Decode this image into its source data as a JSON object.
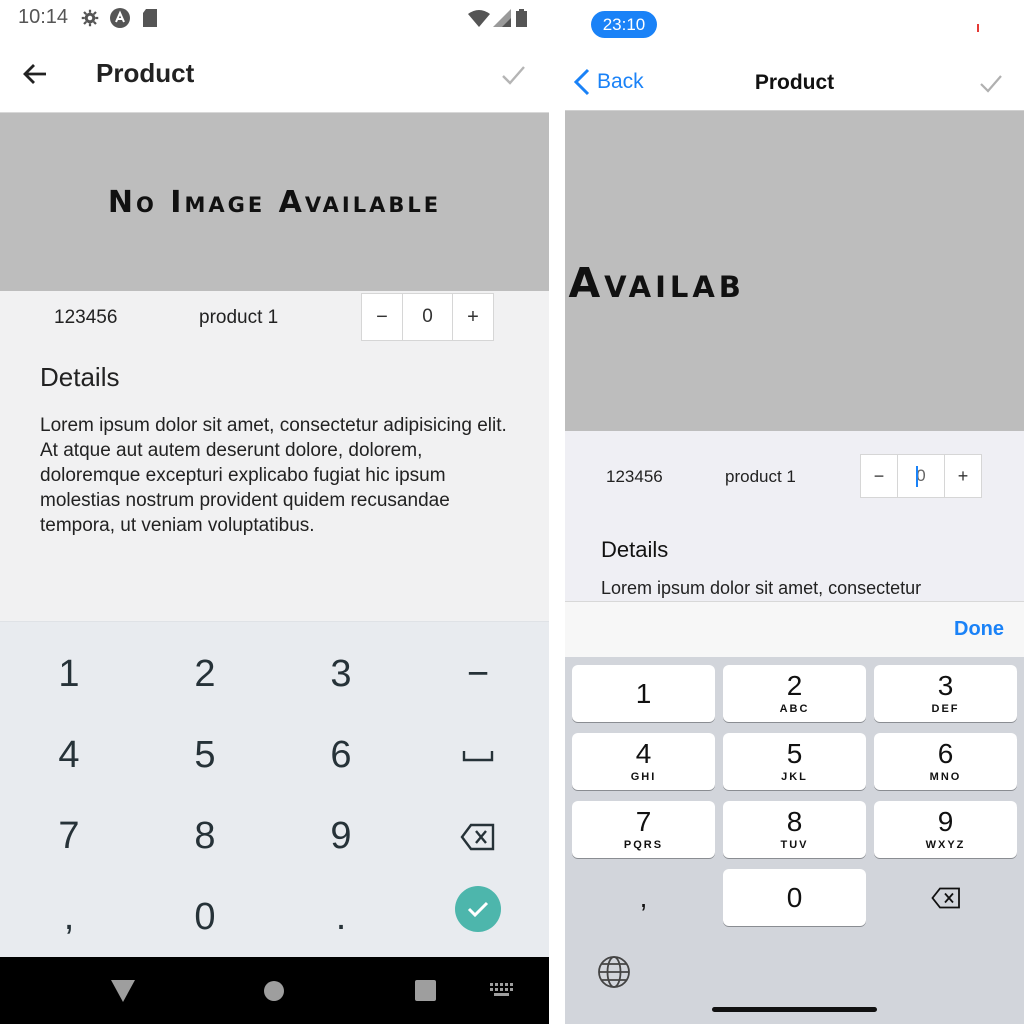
{
  "android": {
    "status": {
      "time": "10:14"
    },
    "toolbar": {
      "title": "Product"
    },
    "image": {
      "placeholder_text": "No Image Available"
    },
    "product": {
      "sku": "123456",
      "name": "product 1"
    },
    "stepper": {
      "minus": "−",
      "value": "0",
      "plus": "+"
    },
    "details": {
      "heading": "Details",
      "text": "Lorem ipsum dolor sit amet, consectetur adipisicing elit. At atque aut autem deserunt dolore, dolorem, doloremque excepturi explicabo fugiat hic ipsum molestias nostrum provident quidem recusandae tempora, ut veniam voluptatibus."
    },
    "keyboard": {
      "keys": [
        "1",
        "2",
        "3",
        "−",
        "4",
        "5",
        "6",
        "␣",
        "7",
        "8",
        "9",
        "⌫",
        ",",
        "0",
        ".",
        "✓"
      ]
    },
    "colors": {
      "accent": "#4db6ac",
      "image_bg": "#bdbdbd"
    }
  },
  "ios": {
    "status": {
      "time": "23:10"
    },
    "nav": {
      "back": "Back",
      "title": "Product"
    },
    "image": {
      "placeholder_text": "Image Availab"
    },
    "product": {
      "sku": "123456",
      "name": "product 1"
    },
    "stepper": {
      "minus": "−",
      "value": "0",
      "plus": "+"
    },
    "details": {
      "heading": "Details",
      "text": "Lorem ipsum dolor sit amet, consectetur"
    },
    "accessory": {
      "done": "Done"
    },
    "keyboard": {
      "keys": [
        {
          "num": "1",
          "sub": ""
        },
        {
          "num": "2",
          "sub": "ABC"
        },
        {
          "num": "3",
          "sub": "DEF"
        },
        {
          "num": "4",
          "sub": "GHI"
        },
        {
          "num": "5",
          "sub": "JKL"
        },
        {
          "num": "6",
          "sub": "MNO"
        },
        {
          "num": "7",
          "sub": "PQRS"
        },
        {
          "num": "8",
          "sub": "TUV"
        },
        {
          "num": "9",
          "sub": "WXYZ"
        },
        {
          "num": ",",
          "sub": ""
        },
        {
          "num": "0",
          "sub": ""
        },
        {
          "num": "⌫",
          "sub": ""
        }
      ]
    },
    "colors": {
      "accent": "#1a82f7",
      "keyboard_bg": "#d2d5db"
    }
  }
}
